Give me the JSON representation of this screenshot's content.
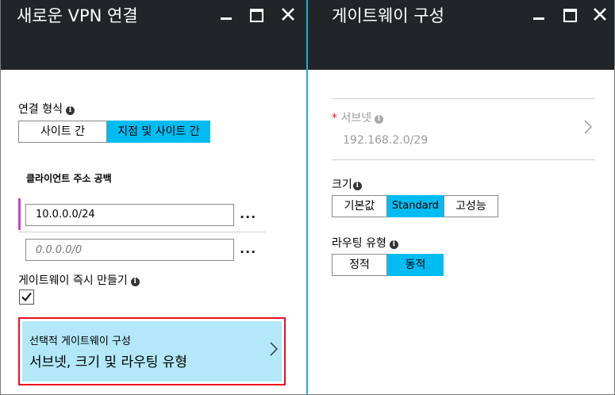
{
  "left_blade": {
    "title": "새로운 VPN 연결",
    "connection_type_label": "연결 형식",
    "connection_types": [
      "사이트 간",
      "지점 및 사이트 간"
    ],
    "client_address_space_label": "클라이언트 주소 공백",
    "address_values": [
      "10.0.0.0/24",
      ""
    ],
    "address_placeholder": "0.0.0.0/0",
    "more_label": "...",
    "create_gateway_label": "게이트웨이 즉시 만들기",
    "create_gateway_checked": true,
    "optional_config_title": "선택적 게이트웨이 구성",
    "optional_config_subtitle": "서브넷, 크기 및 라우팅 유형"
  },
  "right_blade": {
    "title": "게이트웨이 구성",
    "subnet_required_mark": "*",
    "subnet_label": "서브넷",
    "subnet_value": "192.168.2.0/29",
    "size_label": "크기",
    "size_options": [
      "기본값",
      "Standard",
      "고성능"
    ],
    "routing_label": "라우팅 유형",
    "routing_options": [
      "정적",
      "동적"
    ]
  },
  "colors": {
    "accent": "#00bcf2",
    "header": "#222527",
    "highlight_border": "#e81123",
    "accent_bar": "#c846c8"
  }
}
